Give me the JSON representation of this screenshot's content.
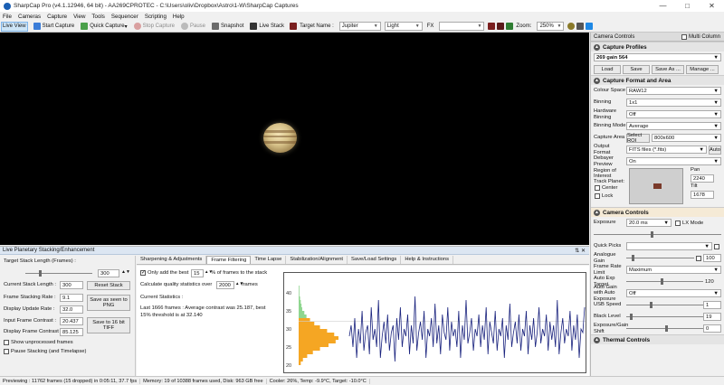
{
  "window": {
    "title": "SharpCap Pro (v4.1.12946, 64 bit) - AA269CPROTEC - C:\\Users\\oliv\\Dropbox\\Astro\\1-W\\SharpCap Captures"
  },
  "menu": [
    "File",
    "Cameras",
    "Capture",
    "View",
    "Tools",
    "Sequencer",
    "Scripting",
    "Help"
  ],
  "toolbar": {
    "live_view": "Live View",
    "start_capture": "Start Capture",
    "quick_capture": "Quick Capture",
    "stop_capture": "Stop Capture",
    "pause": "Pause",
    "snapshot": "Snapshot",
    "live_stack": "Live Stack",
    "target_name_label": "Target Name :",
    "target_name_value": "Jupiter",
    "target_type_value": "Light",
    "fx_label": "FX",
    "zoom_label": "Zoom:",
    "zoom_value": "250%"
  },
  "camera_controls": {
    "header": "Camera Controls",
    "multi_column": "Multi Column",
    "profiles": {
      "title": "Capture Profiles",
      "current": "269 gain 564",
      "load": "Load",
      "save": "Save",
      "save_as": "Save As ...",
      "manage": "Manage ..."
    },
    "format": {
      "title": "Capture Format and Area",
      "colour_space_label": "Colour Space",
      "colour_space": "RAW12",
      "binning_label": "Binning",
      "binning": "1x1",
      "hw_binning_label": "Hardware Binning",
      "hw_binning": "Off",
      "binning_mode_label": "Binning Mode",
      "binning_mode": "Average",
      "capture_area_label": "Capture Area",
      "select_roi": "Select ROI",
      "capture_area": "800x600",
      "output_format_label": "Output Format",
      "output_format": "FITS files (*.fits)",
      "auto": "Auto",
      "debayer_label": "Debayer Preview",
      "debayer": "On",
      "roi_label": "Region of Interest",
      "pan_label": "Pan",
      "pan_value": "2240",
      "tilt_label": "Tilt",
      "tilt_value": "1678",
      "track_planet_label": "Track Planet:",
      "center_label": "Center",
      "lock_label": "Lock"
    },
    "controls": {
      "title": "Camera Controls",
      "exposure_label": "Exposure",
      "exposure_value": "20.0 ms",
      "lx_mode": "LX Mode",
      "quick_picks_label": "Quick Picks",
      "analogue_gain_label": "Analogue Gain",
      "analogue_gain_value": "100",
      "frame_rate_label": "Frame Rate Limit",
      "frame_rate_value": "Maximum",
      "auto_exp_target_label": "Auto Exp Target",
      "auto_exp_target_value": "120",
      "auto_gain_label": "Auto Gain with Auto Exposure",
      "auto_gain_value": "Off",
      "usb_speed_label": "USB Speed",
      "usb_speed_value": "1",
      "black_level_label": "Black Level",
      "black_level_value": "19",
      "exposure_gain_shift_label": "Exposure/Gain Shift",
      "exposure_gain_shift_value": "0"
    },
    "thermal_title": "Thermal Controls"
  },
  "stacking": {
    "title": "Live Planetary Stacking/Enhancement",
    "target_stack_length_label": "Target Stack Length (Frames) :",
    "target_stack_length_value": "300",
    "current_stack_length_label": "Current Stack Length :",
    "current_stack_length_value": "300",
    "reset_stack": "Reset Stack",
    "frame_stacking_rate_label": "Frame Stacking Rate :",
    "frame_stacking_rate_value": "9.1",
    "save_png": "Save as seen to PNG",
    "display_update_rate_label": "Display Update Rate :",
    "display_update_rate_value": "32.0",
    "input_contrast_label": "Input Frame Contrast :",
    "input_contrast_value": "20.437",
    "save_tiff": "Save to 16 bit TIFF",
    "display_contrast_label": "Display Frame Contrast :",
    "display_contrast_value": "85.125",
    "show_unprocessed": "Show unprocessed frames",
    "pause_stacking": "Pause Stacking (and Timelapse)",
    "tabs": [
      "Sharpening & Adjustments",
      "Frame Filtering",
      "Time Lapse",
      "Stabilization/Alignment",
      "Save/Load Settings",
      "Help & Instructions"
    ],
    "filter": {
      "only_add_best_prefix": "Only add the best",
      "best_value": "15",
      "only_add_best_suffix": "% of frames to the stack",
      "calc_prefix": "Calculate quality statistics over",
      "calc_value": "2000",
      "calc_suffix": "frames",
      "stats_title": "Current Statistics :",
      "stats_line1": "Last 1666 frames : Average contrast was 25.187, best",
      "stats_line2": "15% threshold is at 32.140"
    }
  },
  "chart_data": {
    "type": "line",
    "title": "",
    "xlabel": "",
    "ylabel": "",
    "ylim": [
      18,
      45
    ],
    "yticks": [
      20,
      25,
      30,
      35,
      40
    ],
    "threshold": 32.14,
    "series": [
      {
        "values": [
          28,
          31,
          25,
          33,
          22,
          30,
          26,
          35,
          24,
          29,
          31,
          23,
          36,
          27,
          30,
          25,
          38,
          22,
          28,
          32,
          26,
          34,
          24,
          29,
          31,
          21,
          33,
          27,
          36,
          25,
          30,
          28,
          34,
          23,
          31,
          26,
          39,
          24,
          29,
          32,
          27,
          35,
          22,
          30,
          28,
          33,
          25,
          37,
          26,
          31,
          23,
          34,
          29,
          27,
          36,
          24,
          32,
          28,
          30,
          25,
          35,
          22,
          31,
          27,
          38,
          26,
          29,
          33,
          24,
          30,
          28,
          34,
          25,
          31,
          27,
          36,
          23,
          32,
          29,
          26,
          35,
          24,
          30,
          28,
          33,
          22,
          31,
          27,
          37,
          25,
          29,
          32,
          26,
          34,
          24,
          30,
          28,
          35,
          23,
          31,
          27,
          33,
          25,
          29,
          36,
          26,
          30,
          28,
          34,
          24,
          32,
          27,
          31,
          25,
          38,
          23,
          29,
          33,
          26,
          30,
          28,
          35,
          24,
          31,
          27,
          34,
          22,
          30,
          29,
          36
        ]
      }
    ],
    "histogram": {
      "bins": [
        20,
        21,
        22,
        23,
        24,
        25,
        26,
        27,
        28,
        29,
        30,
        31,
        32,
        33,
        34,
        35,
        36,
        37,
        38,
        39,
        40,
        41,
        42
      ],
      "counts": [
        3,
        6,
        12,
        20,
        30,
        42,
        52,
        56,
        50,
        40,
        30,
        22,
        16,
        11,
        8,
        5,
        4,
        3,
        2,
        1,
        1,
        1,
        0
      ]
    },
    "colors": {
      "line": "#1a237e",
      "hist_below": "#f5a623",
      "hist_above": "#8fd68f"
    }
  },
  "status": {
    "previewing": "Previewing : 11762 frames (15 dropped) in 0:05:11, 37.7 fps",
    "memory": "Memory: 19 of 10388 frames used, Disk: 963 GB free",
    "cooler": "Cooler: 26%, Temp: -9.9°C, Target: -10.0°C"
  }
}
